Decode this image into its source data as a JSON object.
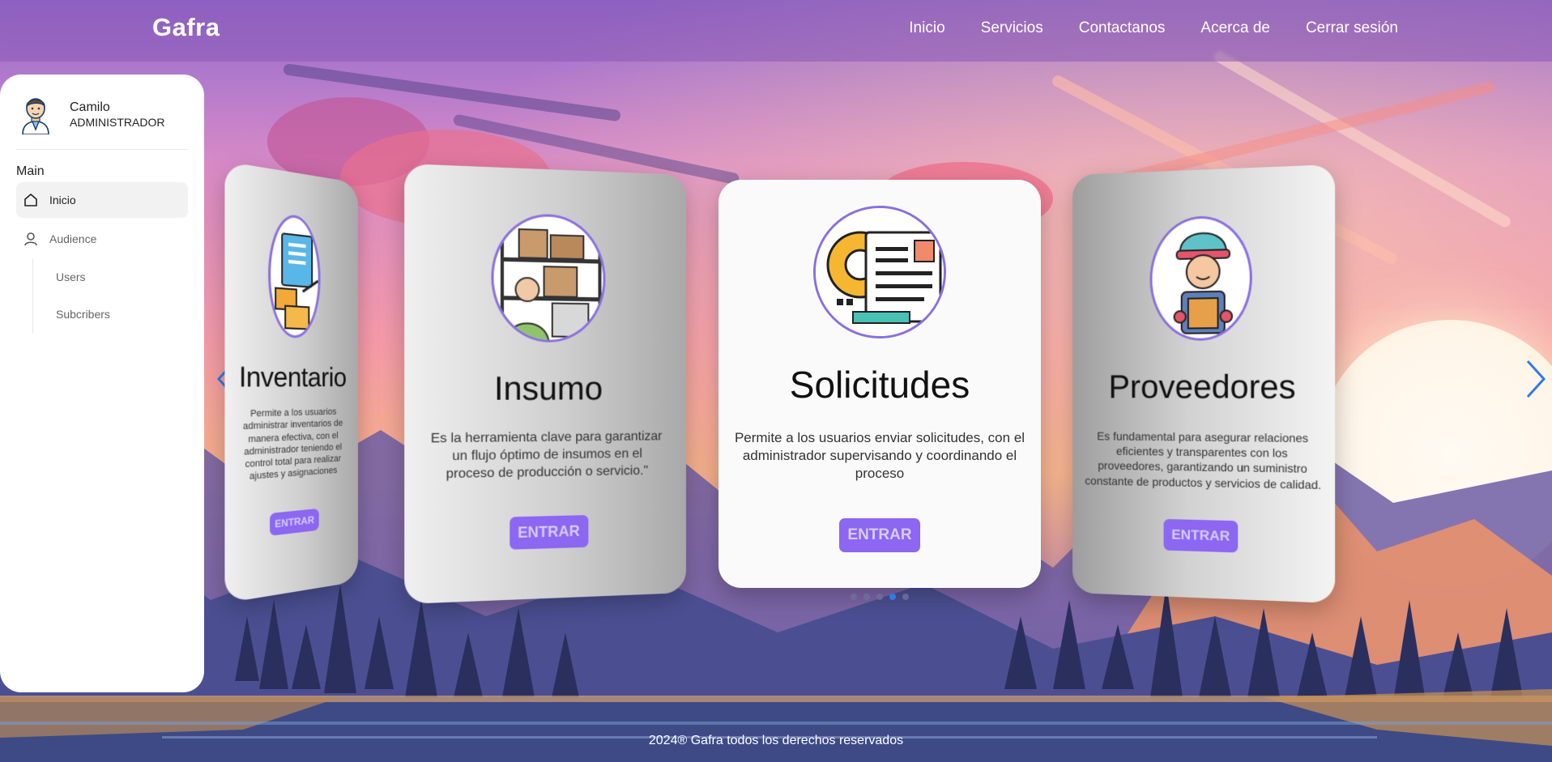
{
  "header": {
    "brand": "Gafra",
    "nav": [
      "Inicio",
      "Servicios",
      "Contactanos",
      "Acerca de",
      "Cerrar sesión"
    ]
  },
  "sidebar": {
    "user": {
      "name": "Camilo",
      "role": "ADMINISTRADOR",
      "avatar_icon": "user-avatar-icon"
    },
    "section_label": "Main",
    "items": [
      {
        "label": "Inicio",
        "icon": "home-icon",
        "active": true
      },
      {
        "label": "Audience",
        "icon": "user-icon",
        "active": false
      }
    ],
    "subitems": [
      "Users",
      "Subcribers"
    ]
  },
  "carousel": {
    "cards": [
      {
        "title": "Inventario",
        "description": "Permite a los usuarios administrar inventarios de manera efectiva, con el administrador teniendo el control total para realizar ajustes y asignaciones",
        "button": "ENTRAR",
        "icon": "inventory-icon"
      },
      {
        "title": "Insumo",
        "description": "Es la herramienta clave para garantizar un flujo óptimo de insumos en el proceso de producción o servicio.\"",
        "button": "ENTRAR",
        "icon": "supplies-icon"
      },
      {
        "title": "Solicitudes",
        "description": "Permite a los usuarios enviar solicitudes, con el administrador supervisando y coordinando el proceso",
        "button": "ENTRAR",
        "icon": "requests-icon"
      },
      {
        "title": "Proveedores",
        "description": "Es fundamental para asegurar relaciones eficientes y transparentes con los proveedores, garantizando un suministro constante de productos y servicios de calidad.",
        "button": "ENTRAR",
        "icon": "supplier-icon"
      }
    ],
    "dots_total": 5,
    "dots_active_index": 3,
    "arrow_left_icon": "chevron-left-icon",
    "arrow_right_icon": "chevron-right-icon"
  },
  "footer": {
    "text": "2024® Gafra todos los derechos reservados"
  },
  "colors": {
    "accent": "#8b67f2",
    "arrow": "#2f7be6",
    "active_dot": "#2f7be6"
  }
}
